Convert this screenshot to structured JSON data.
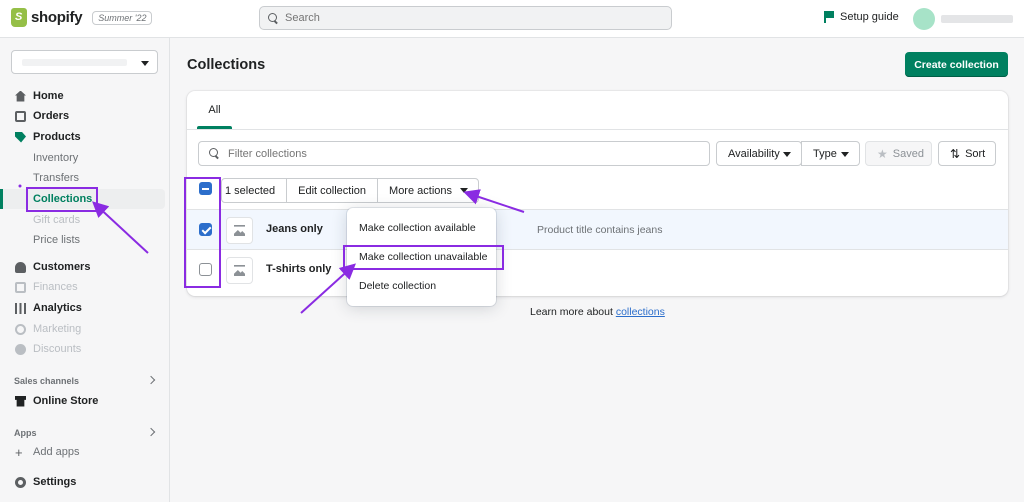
{
  "topbar": {
    "brand": "shopify",
    "edition": "Summer '22",
    "search_placeholder": "Search",
    "setup_guide": "Setup guide"
  },
  "sidebar": {
    "items": [
      {
        "label": "Home",
        "icon": "home-icon"
      },
      {
        "label": "Orders",
        "icon": "orders-icon"
      },
      {
        "label": "Products",
        "icon": "tag-icon"
      },
      {
        "label": "Inventory"
      },
      {
        "label": "Transfers"
      },
      {
        "label": "Collections"
      },
      {
        "label": "Gift cards"
      },
      {
        "label": "Price lists"
      },
      {
        "label": "Customers",
        "icon": "person-icon"
      },
      {
        "label": "Finances",
        "icon": "finances-icon"
      },
      {
        "label": "Analytics",
        "icon": "bar-chart-icon"
      },
      {
        "label": "Marketing",
        "icon": "target-icon"
      },
      {
        "label": "Discounts",
        "icon": "discount-icon"
      },
      {
        "label": "Online Store",
        "icon": "store-icon"
      },
      {
        "label": "Add apps",
        "icon": "plus-icon"
      },
      {
        "label": "Settings",
        "icon": "gear-icon"
      }
    ],
    "sales_channels": "Sales channels",
    "apps": "Apps"
  },
  "main": {
    "title": "Collections",
    "create_button": "Create collection",
    "tab_all": "All",
    "filter_placeholder": "Filter collections",
    "availability": "Availability",
    "type": "Type",
    "saved": "Saved",
    "sort": "Sort",
    "bulk": {
      "selected": "1 selected",
      "edit": "Edit collection",
      "more": "More actions"
    },
    "rows": [
      {
        "title": "Jeans only",
        "condition": "Product title contains jeans",
        "checked": true
      },
      {
        "title": "T-shirts only",
        "condition": "",
        "checked": false
      }
    ],
    "menu": [
      "Make collection available",
      "Make collection unavailable",
      "Delete collection"
    ],
    "learn_prefix": "Learn more about",
    "learn_link": "collections"
  },
  "colors": {
    "accent": "#008060",
    "selection": "#2c6ecb",
    "annotation": "#8a2be2"
  }
}
